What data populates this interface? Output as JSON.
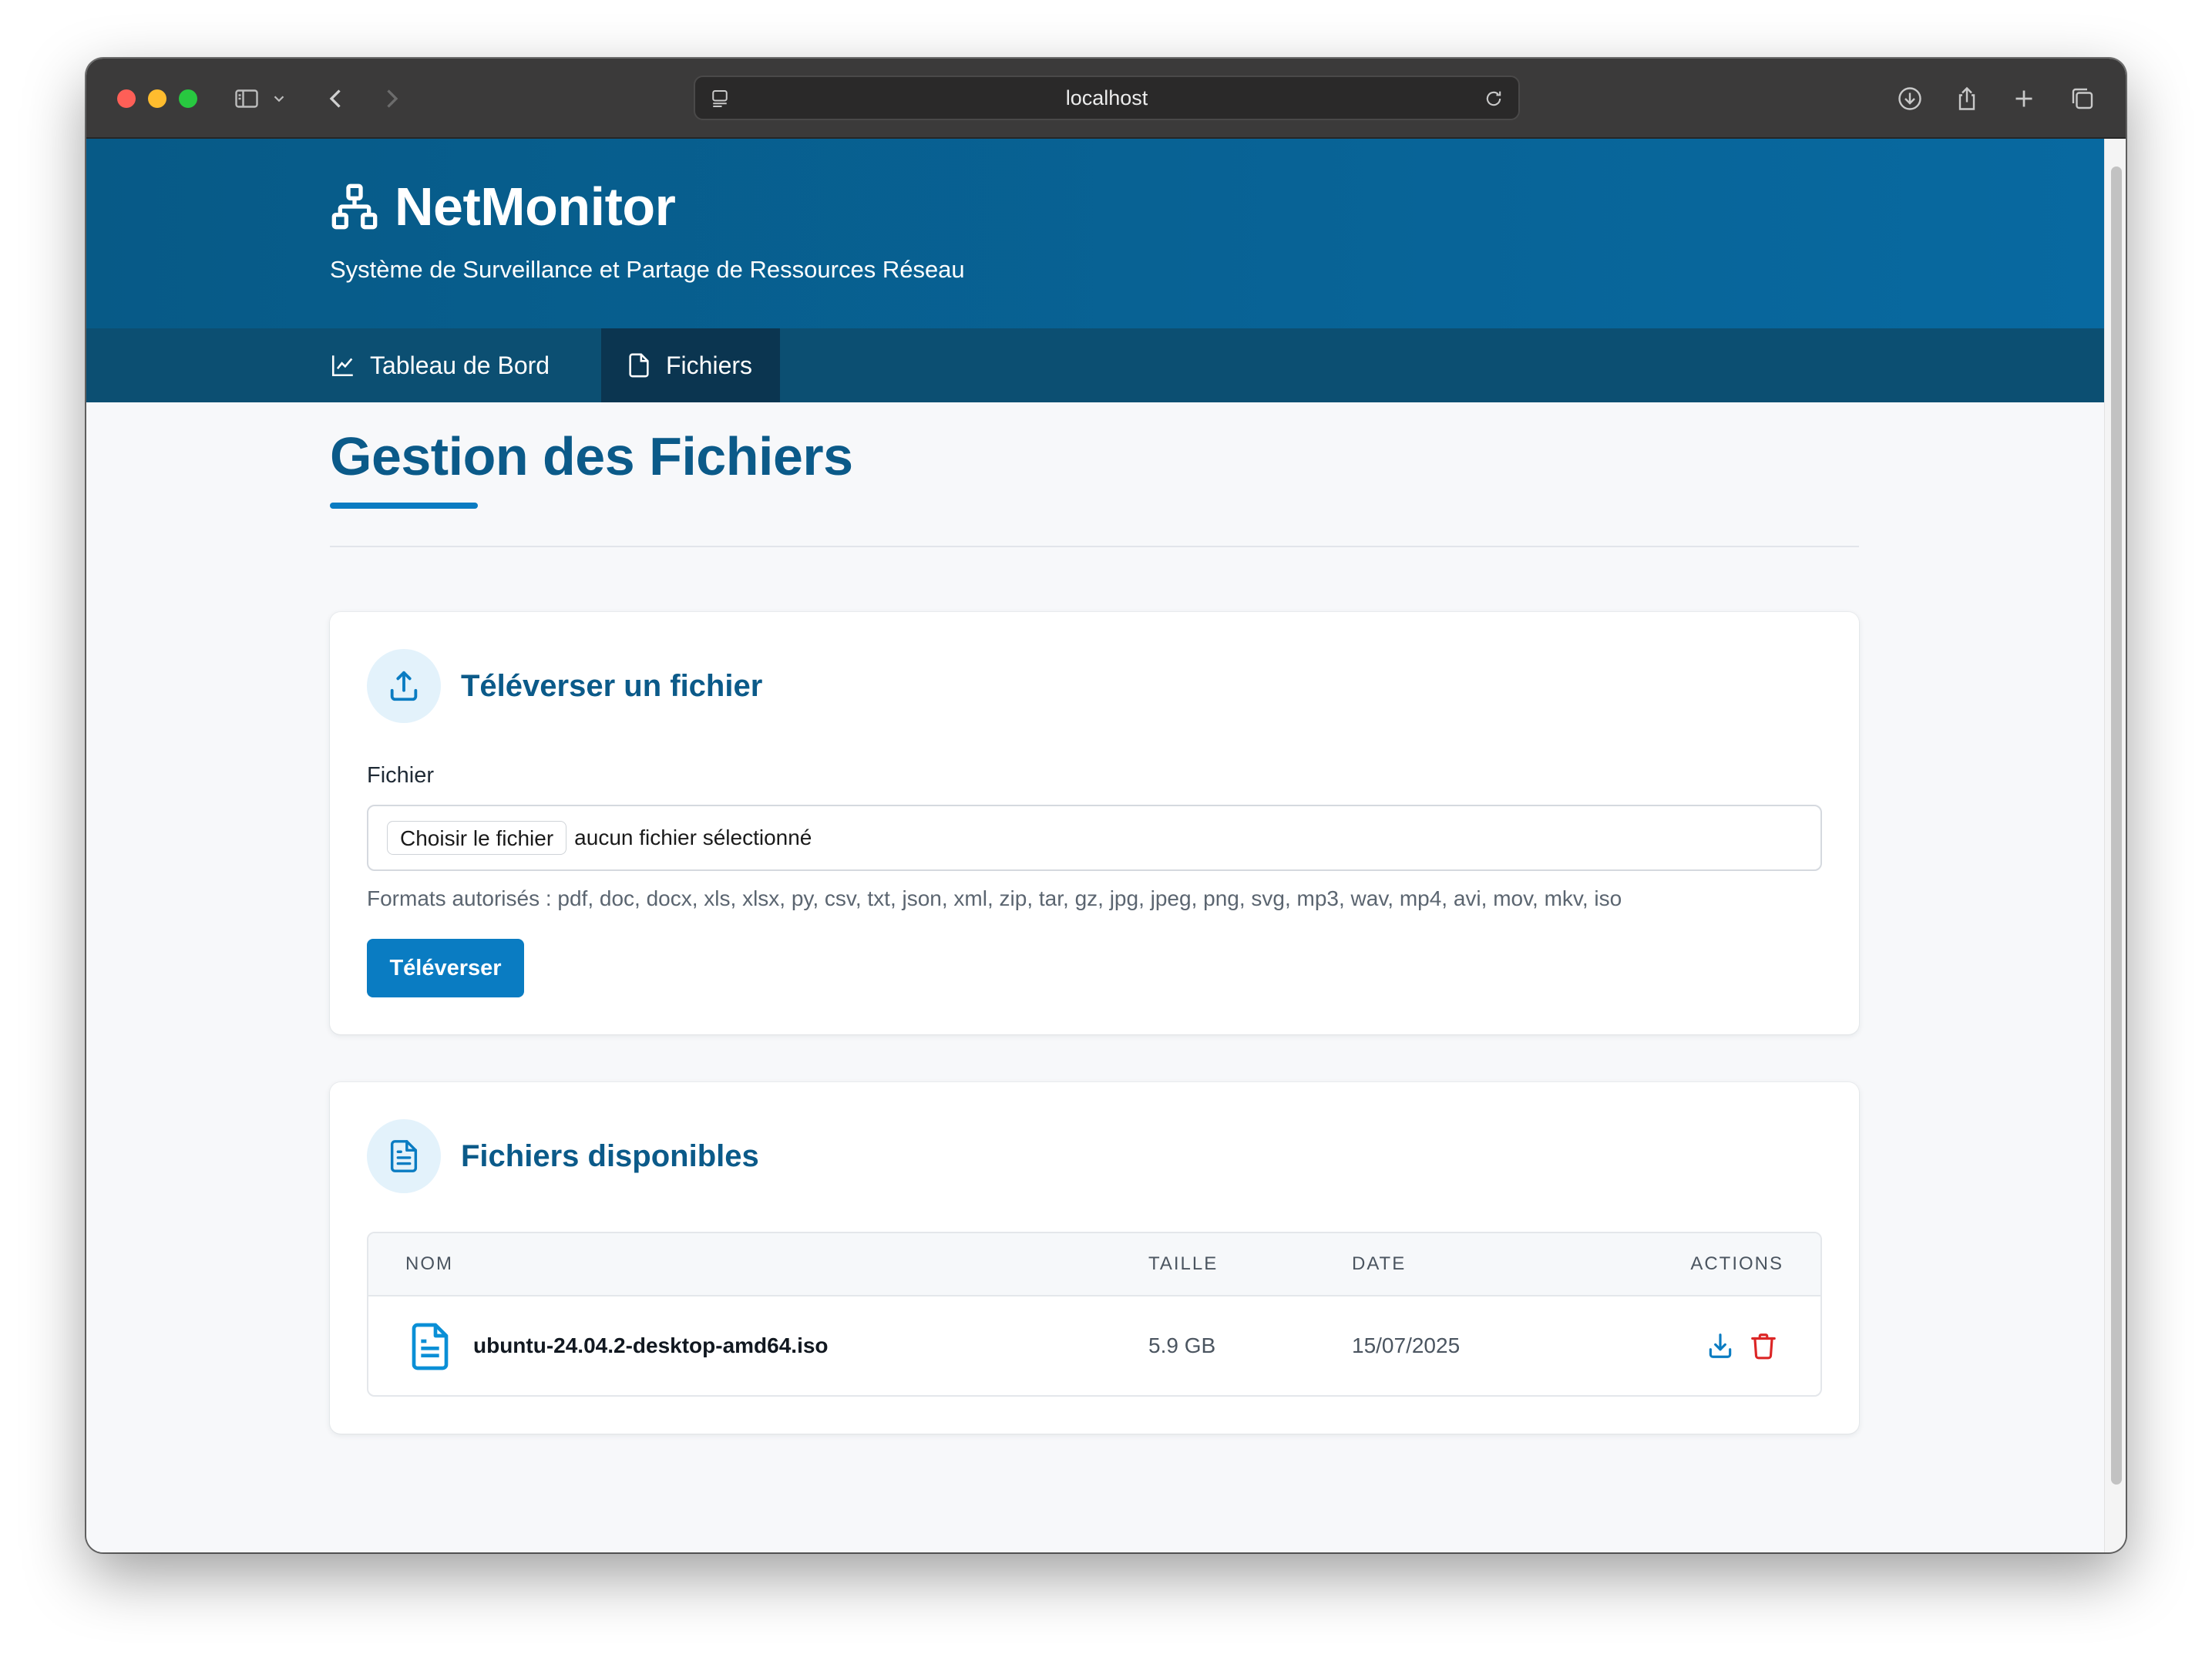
{
  "browser": {
    "url": "localhost",
    "icons": [
      "sidebar-icon",
      "chevron-down-icon",
      "back-icon",
      "forward-icon",
      "page-menu-icon",
      "reload-icon",
      "download-icon",
      "share-icon",
      "new-tab-icon",
      "tabs-overview-icon"
    ]
  },
  "header": {
    "brand": "NetMonitor",
    "brand_icon": "network-icon",
    "tagline": "Système de Surveillance et Partage de Ressources Réseau"
  },
  "nav": {
    "items": [
      {
        "label": "Tableau de Bord",
        "icon": "chart-line-icon",
        "active": false
      },
      {
        "label": "Fichiers",
        "icon": "file-icon",
        "active": true
      }
    ]
  },
  "page": {
    "title": "Gestion des Fichiers"
  },
  "upload": {
    "title": "Téléverser un fichier",
    "icon": "upload-icon",
    "field_label": "Fichier",
    "choose_button": "Choisir le fichier",
    "no_file_text": "aucun fichier sélectionné",
    "help": "Formats autorisés : pdf, doc, docx, xls, xlsx, py, csv, txt, json, xml, zip, tar, gz, jpg, jpeg, png, svg, mp3, wav, mp4, avi, mov, mkv, iso",
    "submit": "Téléverser"
  },
  "files": {
    "title": "Fichiers disponibles",
    "icon": "file-text-icon",
    "columns": [
      "NOM",
      "TAILLE",
      "DATE",
      "ACTIONS"
    ],
    "rows": [
      {
        "name": "ubuntu-24.04.2-desktop-amd64.iso",
        "size": "5.9 GB",
        "date": "15/07/2025",
        "actions": [
          "download-icon",
          "trash-icon"
        ]
      }
    ]
  },
  "colors": {
    "header_bg": "#0869a0",
    "nav_bg": "#0c4f72",
    "nav_active_bg": "#0b3550",
    "primary": "#0a7cc2",
    "title": "#0b5a89",
    "delete": "#dc2626",
    "footer_bg": "#1e2939"
  }
}
